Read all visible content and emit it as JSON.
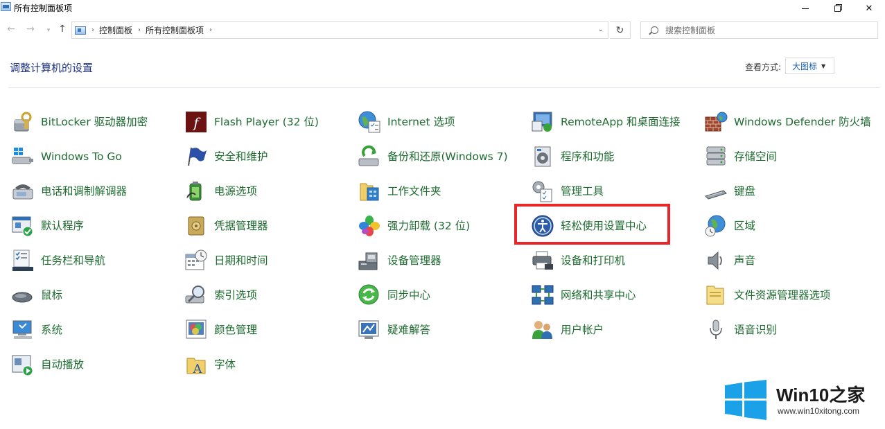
{
  "window": {
    "title": "所有控制面板项",
    "controls": {
      "minimize": "minimize-icon",
      "maximize": "maximize-icon",
      "close": "close-icon"
    }
  },
  "nav": {
    "breadcrumbs": [
      "控制面板",
      "所有控制面板项"
    ],
    "search_placeholder": "搜索控制面板"
  },
  "header": {
    "title": "调整计算机的设置",
    "view_by_label": "查看方式:",
    "view_by_value": "大图标"
  },
  "items": [
    {
      "label": "BitLocker 驱动器加密",
      "icon": "bitlocker-icon"
    },
    {
      "label": "Flash Player (32 位)",
      "icon": "flash-player-icon"
    },
    {
      "label": "Internet 选项",
      "icon": "internet-options-icon"
    },
    {
      "label": "RemoteApp 和桌面连接",
      "icon": "remoteapp-icon"
    },
    {
      "label": "Windows Defender 防火墙",
      "icon": "firewall-icon"
    },
    {
      "label": "Windows To Go",
      "icon": "windows-to-go-icon"
    },
    {
      "label": "安全和维护",
      "icon": "security-flag-icon"
    },
    {
      "label": "备份和还原(Windows 7)",
      "icon": "backup-icon"
    },
    {
      "label": "程序和功能",
      "icon": "programs-icon"
    },
    {
      "label": "存储空间",
      "icon": "storage-icon"
    },
    {
      "label": "电话和调制解调器",
      "icon": "phone-modem-icon"
    },
    {
      "label": "电源选项",
      "icon": "power-icon"
    },
    {
      "label": "工作文件夹",
      "icon": "work-folders-icon"
    },
    {
      "label": "管理工具",
      "icon": "admin-tools-icon"
    },
    {
      "label": "键盘",
      "icon": "keyboard-icon"
    },
    {
      "label": "默认程序",
      "icon": "default-programs-icon"
    },
    {
      "label": "凭据管理器",
      "icon": "credential-icon"
    },
    {
      "label": "强力卸载 (32 位)",
      "icon": "uninstall-icon"
    },
    {
      "label": "轻松使用设置中心",
      "icon": "ease-of-access-icon"
    },
    {
      "label": "区域",
      "icon": "region-icon"
    },
    {
      "label": "任务栏和导航",
      "icon": "taskbar-icon"
    },
    {
      "label": "日期和时间",
      "icon": "calendar-icon"
    },
    {
      "label": "设备管理器",
      "icon": "device-manager-icon"
    },
    {
      "label": "设备和打印机",
      "icon": "printer-icon"
    },
    {
      "label": "声音",
      "icon": "speaker-icon"
    },
    {
      "label": "鼠标",
      "icon": "mouse-icon"
    },
    {
      "label": "索引选项",
      "icon": "indexing-icon"
    },
    {
      "label": "同步中心",
      "icon": "sync-icon"
    },
    {
      "label": "网络和共享中心",
      "icon": "network-icon"
    },
    {
      "label": "文件资源管理器选项",
      "icon": "folder-options-icon"
    },
    {
      "label": "系统",
      "icon": "system-icon"
    },
    {
      "label": "颜色管理",
      "icon": "color-management-icon"
    },
    {
      "label": "疑难解答",
      "icon": "troubleshoot-icon"
    },
    {
      "label": "用户帐户",
      "icon": "user-accounts-icon"
    },
    {
      "label": "语音识别",
      "icon": "microphone-icon"
    },
    {
      "label": "自动播放",
      "icon": "autoplay-icon"
    },
    {
      "label": "字体",
      "icon": "fonts-icon"
    }
  ],
  "highlighted_item": "轻松使用设置中心",
  "watermark": {
    "brand_prefix": "Win10",
    "brand_suffix": "之家",
    "site": "www.win10xitong.com"
  },
  "colors": {
    "link_green": "#1d6b2f",
    "heading_blue": "#1e3287",
    "highlight_red": "#e8262a",
    "win_logo_blue": "#1aa1e8"
  }
}
